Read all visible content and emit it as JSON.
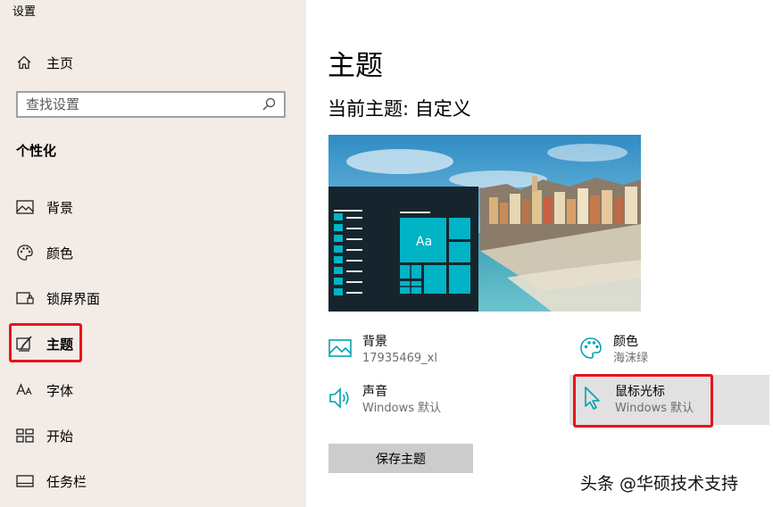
{
  "window": {
    "title": "设置"
  },
  "sidebar": {
    "home_label": "主页",
    "search_placeholder": "查找设置",
    "section_title": "个性化",
    "items": [
      {
        "label": "背景",
        "icon": "image-icon"
      },
      {
        "label": "颜色",
        "icon": "palette-icon"
      },
      {
        "label": "锁屏界面",
        "icon": "lock-screen-icon"
      },
      {
        "label": "主题",
        "icon": "theme-brush-icon",
        "selected": true
      },
      {
        "label": "字体",
        "icon": "font-icon"
      },
      {
        "label": "开始",
        "icon": "start-icon"
      },
      {
        "label": "任务栏",
        "icon": "taskbar-icon"
      }
    ]
  },
  "main": {
    "title": "主题",
    "current_theme": "当前主题: 自定义",
    "preview_tile_text": "Aa",
    "props": {
      "background": {
        "title": "背景",
        "value": "17935469_xl",
        "icon": "image-icon"
      },
      "color": {
        "title": "颜色",
        "value": "海沫绿",
        "icon": "palette-icon"
      },
      "sound": {
        "title": "声音",
        "value": "Windows 默认",
        "icon": "speaker-icon"
      },
      "cursor": {
        "title": "鼠标光标",
        "value": "Windows 默认",
        "icon": "cursor-icon"
      }
    },
    "save_button": "保存主题"
  },
  "watermark": "头条 @华硕技术支持",
  "colors": {
    "sidebar_bg": "#f2ebe6",
    "accent": "#00b4c5",
    "highlight_red": "#e8141b",
    "button_bg": "#cccccc"
  }
}
